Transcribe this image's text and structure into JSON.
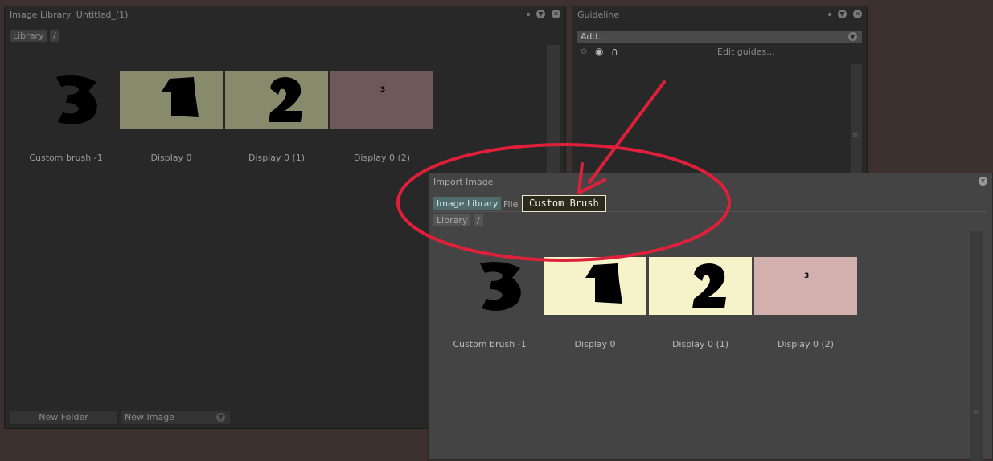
{
  "library_panel": {
    "title": "Image Library: Untitled_(1)",
    "crumbs": [
      "Library",
      "/"
    ],
    "items": [
      {
        "label": "Custom brush -1",
        "glyph": "3"
      },
      {
        "label": "Display 0",
        "glyph": "1"
      },
      {
        "label": "Display 0 (1)",
        "glyph": "2"
      },
      {
        "label": "Display 0 (2)",
        "glyph": "3"
      }
    ],
    "new_folder_label": "New Folder",
    "new_image_label": "New Image",
    "colors": {
      "tile_bg": "#878a6b",
      "tile_bg_pink": "#6d5a58"
    }
  },
  "guideline_panel": {
    "title": "Guideline",
    "add_placeholder": "Add...",
    "edit_guides_label": "Edit guides..."
  },
  "import_panel": {
    "title": "Import Image",
    "tabs": [
      "Image Library",
      "File"
    ],
    "tooltip": "Custom Brush",
    "crumbs": [
      "Library",
      "/"
    ],
    "items": [
      {
        "label": "Custom brush -1",
        "glyph": "3"
      },
      {
        "label": "Display 0",
        "glyph": "1"
      },
      {
        "label": "Display 0 (1)",
        "glyph": "2"
      },
      {
        "label": "Display 0 (2)",
        "glyph": "3"
      }
    ],
    "colors": {
      "tile_bg": "#f6f2ca",
      "tile_bg_pink": "#d2b0ad",
      "active_tab": "#4f6b6b"
    }
  },
  "annotation": {
    "color": "#e0203a",
    "icons": [
      "red-ellipse",
      "red-arrow"
    ]
  }
}
